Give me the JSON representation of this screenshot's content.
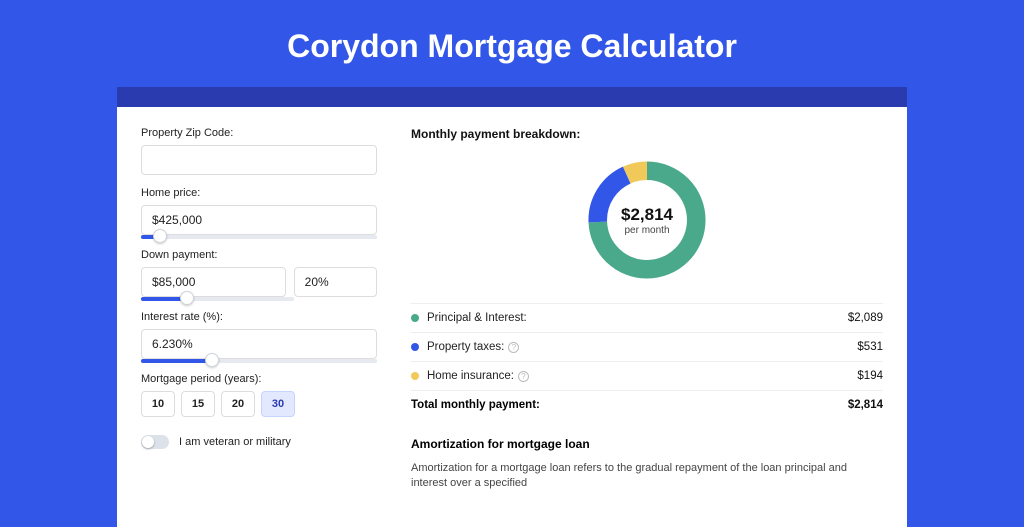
{
  "title": "Corydon Mortgage Calculator",
  "form": {
    "zip_label": "Property Zip Code:",
    "zip_value": "",
    "home_price_label": "Home price:",
    "home_price_value": "$425,000",
    "home_price_slider_pct": 8,
    "down_payment_label": "Down payment:",
    "down_payment_value": "$85,000",
    "down_payment_pct_value": "20%",
    "down_payment_slider_pct": 20,
    "interest_label": "Interest rate (%):",
    "interest_value": "6.230%",
    "interest_slider_pct": 30,
    "period_label": "Mortgage period (years):",
    "period_options": [
      "10",
      "15",
      "20",
      "30"
    ],
    "period_selected": "30",
    "veteran_label": "I am veteran or military"
  },
  "breakdown": {
    "title": "Monthly payment breakdown:",
    "center_value": "$2,814",
    "center_label": "per month",
    "items": [
      {
        "label": "Principal & Interest:",
        "value": "$2,089",
        "color": "#4aa98a",
        "info": false
      },
      {
        "label": "Property taxes:",
        "value": "$531",
        "color": "#3156e8",
        "info": true
      },
      {
        "label": "Home insurance:",
        "value": "$194",
        "color": "#f0c95a",
        "info": true
      }
    ],
    "total_label": "Total monthly payment:",
    "total_value": "$2,814"
  },
  "chart_data": {
    "type": "pie",
    "title": "Monthly payment breakdown",
    "series": [
      {
        "name": "Principal & Interest",
        "value": 2089,
        "color": "#4aa98a"
      },
      {
        "name": "Property taxes",
        "value": 531,
        "color": "#3156e8"
      },
      {
        "name": "Home insurance",
        "value": 194,
        "color": "#f0c95a"
      }
    ],
    "total": 2814
  },
  "amortization": {
    "title": "Amortization for mortgage loan",
    "text": "Amortization for a mortgage loan refers to the gradual repayment of the loan principal and interest over a specified"
  }
}
